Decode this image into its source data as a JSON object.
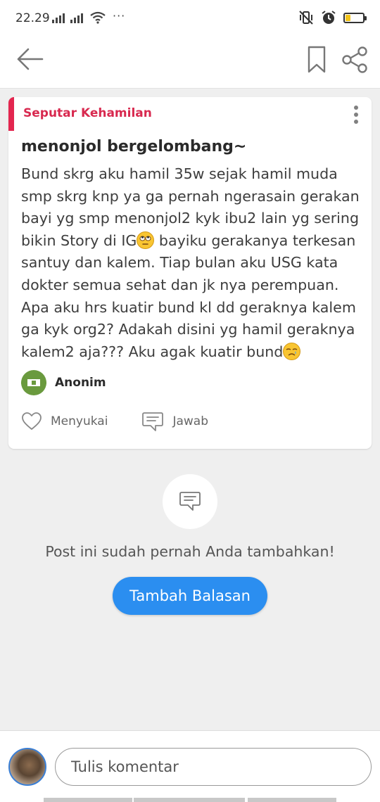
{
  "status_bar": {
    "time": "22.29",
    "dots": "···"
  },
  "toolbar": {
    "back_icon": "arrow-left-icon",
    "bookmark_icon": "bookmark-icon",
    "share_icon": "share-icon"
  },
  "post": {
    "category": "Seputar Kehamilan",
    "category_color": "#e3264f",
    "title": "menonjol bergelombang~",
    "body_lines": [
      "Bund skrg aku hamil 35w sejak hamil muda",
      "smp skrg knp ya ga pernah ngerasain gerakan",
      "bayi yg smp menonjol2 kyk ibu2 lain yg sering",
      "bikin Story di IG",
      " bayiku gerakanya terkesan",
      "santuy dan kalem. Tiap bulan aku USG kata",
      "dokter  semua sehat dan jk nya perempuan.",
      "Apa aku hrs kuatir bund kl dd geraknya kalem",
      "ga kyk org2? Adakah disini yg hamil geraknya",
      "kalem2 aja??? Aku agak kuatir bund"
    ],
    "emojis": [
      "eye-roll-emoji",
      "crying-emoji"
    ],
    "author": "Anonim",
    "like_label": "Menyukai",
    "reply_label": "Jawab"
  },
  "empty_state": {
    "message": "Post ini sudah pernah Anda tambahkan!",
    "button_label": "Tambah Balasan",
    "button_color": "#2b8ef0"
  },
  "comment": {
    "placeholder": "Tulis komentar"
  }
}
